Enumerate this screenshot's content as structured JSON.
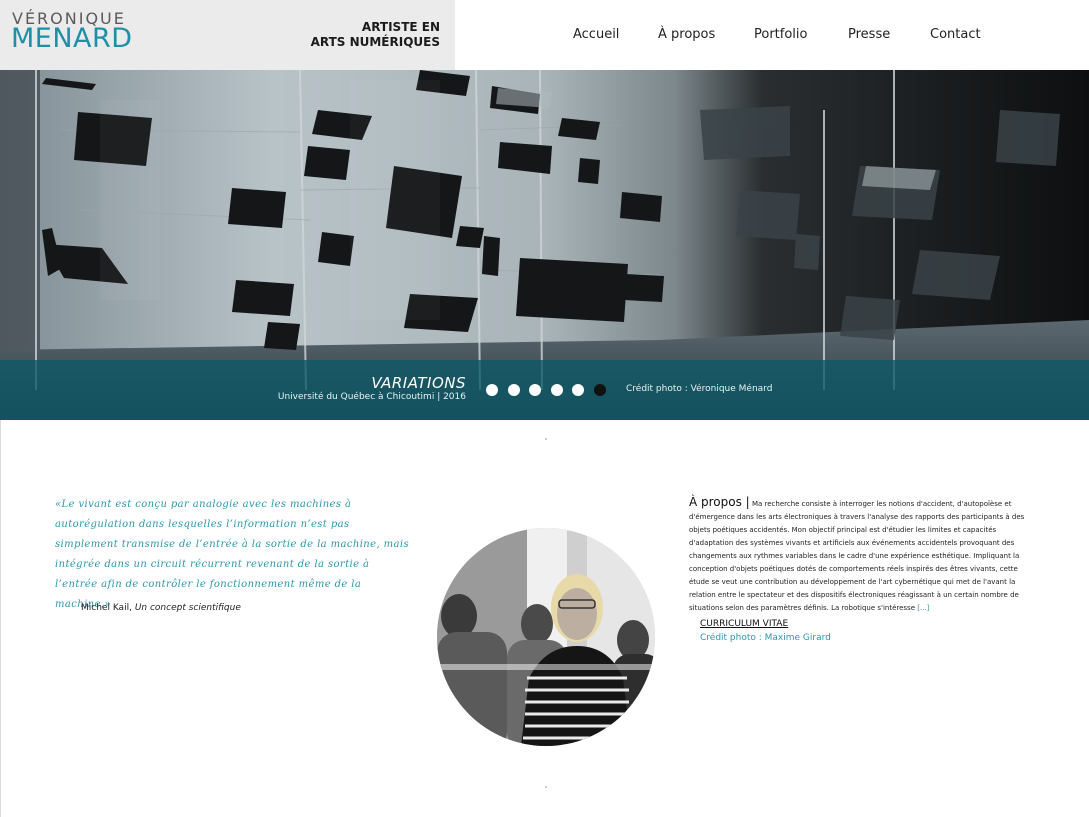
{
  "brand": {
    "logo_top": "VÉRONIQUE",
    "logo_main": "MENARD",
    "tagline_line1": "ARTISTE EN",
    "tagline_line2": "ARTS NUMÉRIQUES"
  },
  "nav": {
    "items": [
      {
        "label": "Accueil"
      },
      {
        "label": "À propos"
      },
      {
        "label": "Portfolio"
      },
      {
        "label": "Presse"
      },
      {
        "label": "Contact"
      }
    ]
  },
  "slider": {
    "title": "VARIATIONS",
    "subtitle": "Université du Québec à Chicoutimi | 2016",
    "credit": "Crédit photo : Véronique Ménard",
    "dot_count": 6,
    "active_index": 5
  },
  "quote": {
    "text": "«Le vivant est conçu par analogie avec les machines à autorégulation dans lesquelles l’information n’est pas simplement transmise de l’entrée à la sortie de la machine, mais intégrée dans un circuit récurrent revenant de la sortie à l’entrée afin de contrôler le fonctionnement même de la machine.»",
    "author": "Michel Kail, ",
    "work": "Un concept scientifique"
  },
  "about": {
    "heading": "À propos |",
    "body": " Ma recherche consiste à interroger les notions d'accident, d'autopoïèse et d'émergence dans les arts électroniques à travers l'analyse des rapports des participants à des objets poétiques accidentés. Mon objectif principal est d'étudier les limites et capacités d'adaptation des systèmes vivants et artificiels aux événements accidentels provoquant des changements aux rythmes variables dans le cadre d'une expérience esthétique. Impliquant la conception d'objets poétiques dotés de comportements réels inspirés des êtres vivants, cette étude se veut une contribution au développement de l'art cybernétique qui met de l'avant la relation entre le spectateur et des dispositifs électroniques réagissant à un certain nombre de situations selon des paramètres définis. La robotique s'intéresse ",
    "more_link": "[...]",
    "cv_link": "CURRICULUM VITAE",
    "photo_credit": "Crédit photo : Maxime Girard"
  },
  "colors": {
    "accent": "#2a98ae",
    "logo": "#1d8fa6",
    "caption_bar": "#0c5866"
  }
}
